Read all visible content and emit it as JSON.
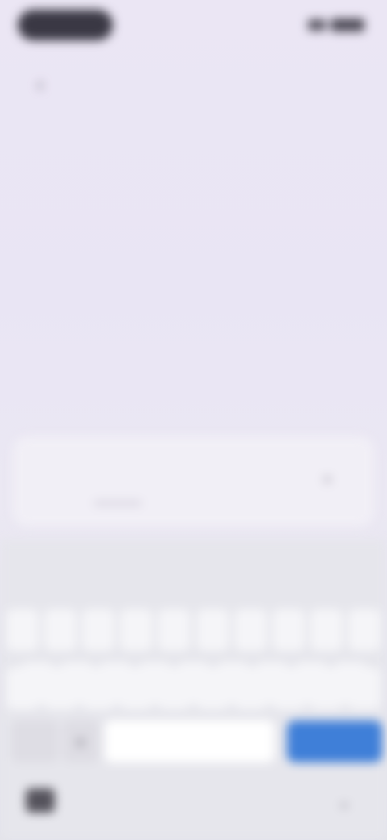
{
  "header": {
    "back_icon": "chevron-left-icon",
    "title": ""
  },
  "input": {
    "value": "",
    "clear_icon": "close-icon"
  },
  "keyboard": {
    "suggestions": [],
    "row1": [
      "",
      "",
      "",
      "",
      "",
      "",
      "",
      "",
      "",
      ""
    ],
    "row2": [
      "",
      "",
      "",
      "",
      "",
      "",
      "",
      "",
      ""
    ],
    "row3": [
      "",
      "",
      "",
      "",
      "",
      "",
      "",
      "",
      "",
      ""
    ],
    "mode_key": "",
    "emoji_icon": "emoji-icon",
    "enter_color": "#3f7fd8"
  },
  "nav": {
    "keyboard_icon": "keyboard-icon",
    "hide_icon": "chevron-down-icon"
  },
  "colors": {
    "background": "#ebe6f4",
    "accent": "#3f7fd8"
  }
}
